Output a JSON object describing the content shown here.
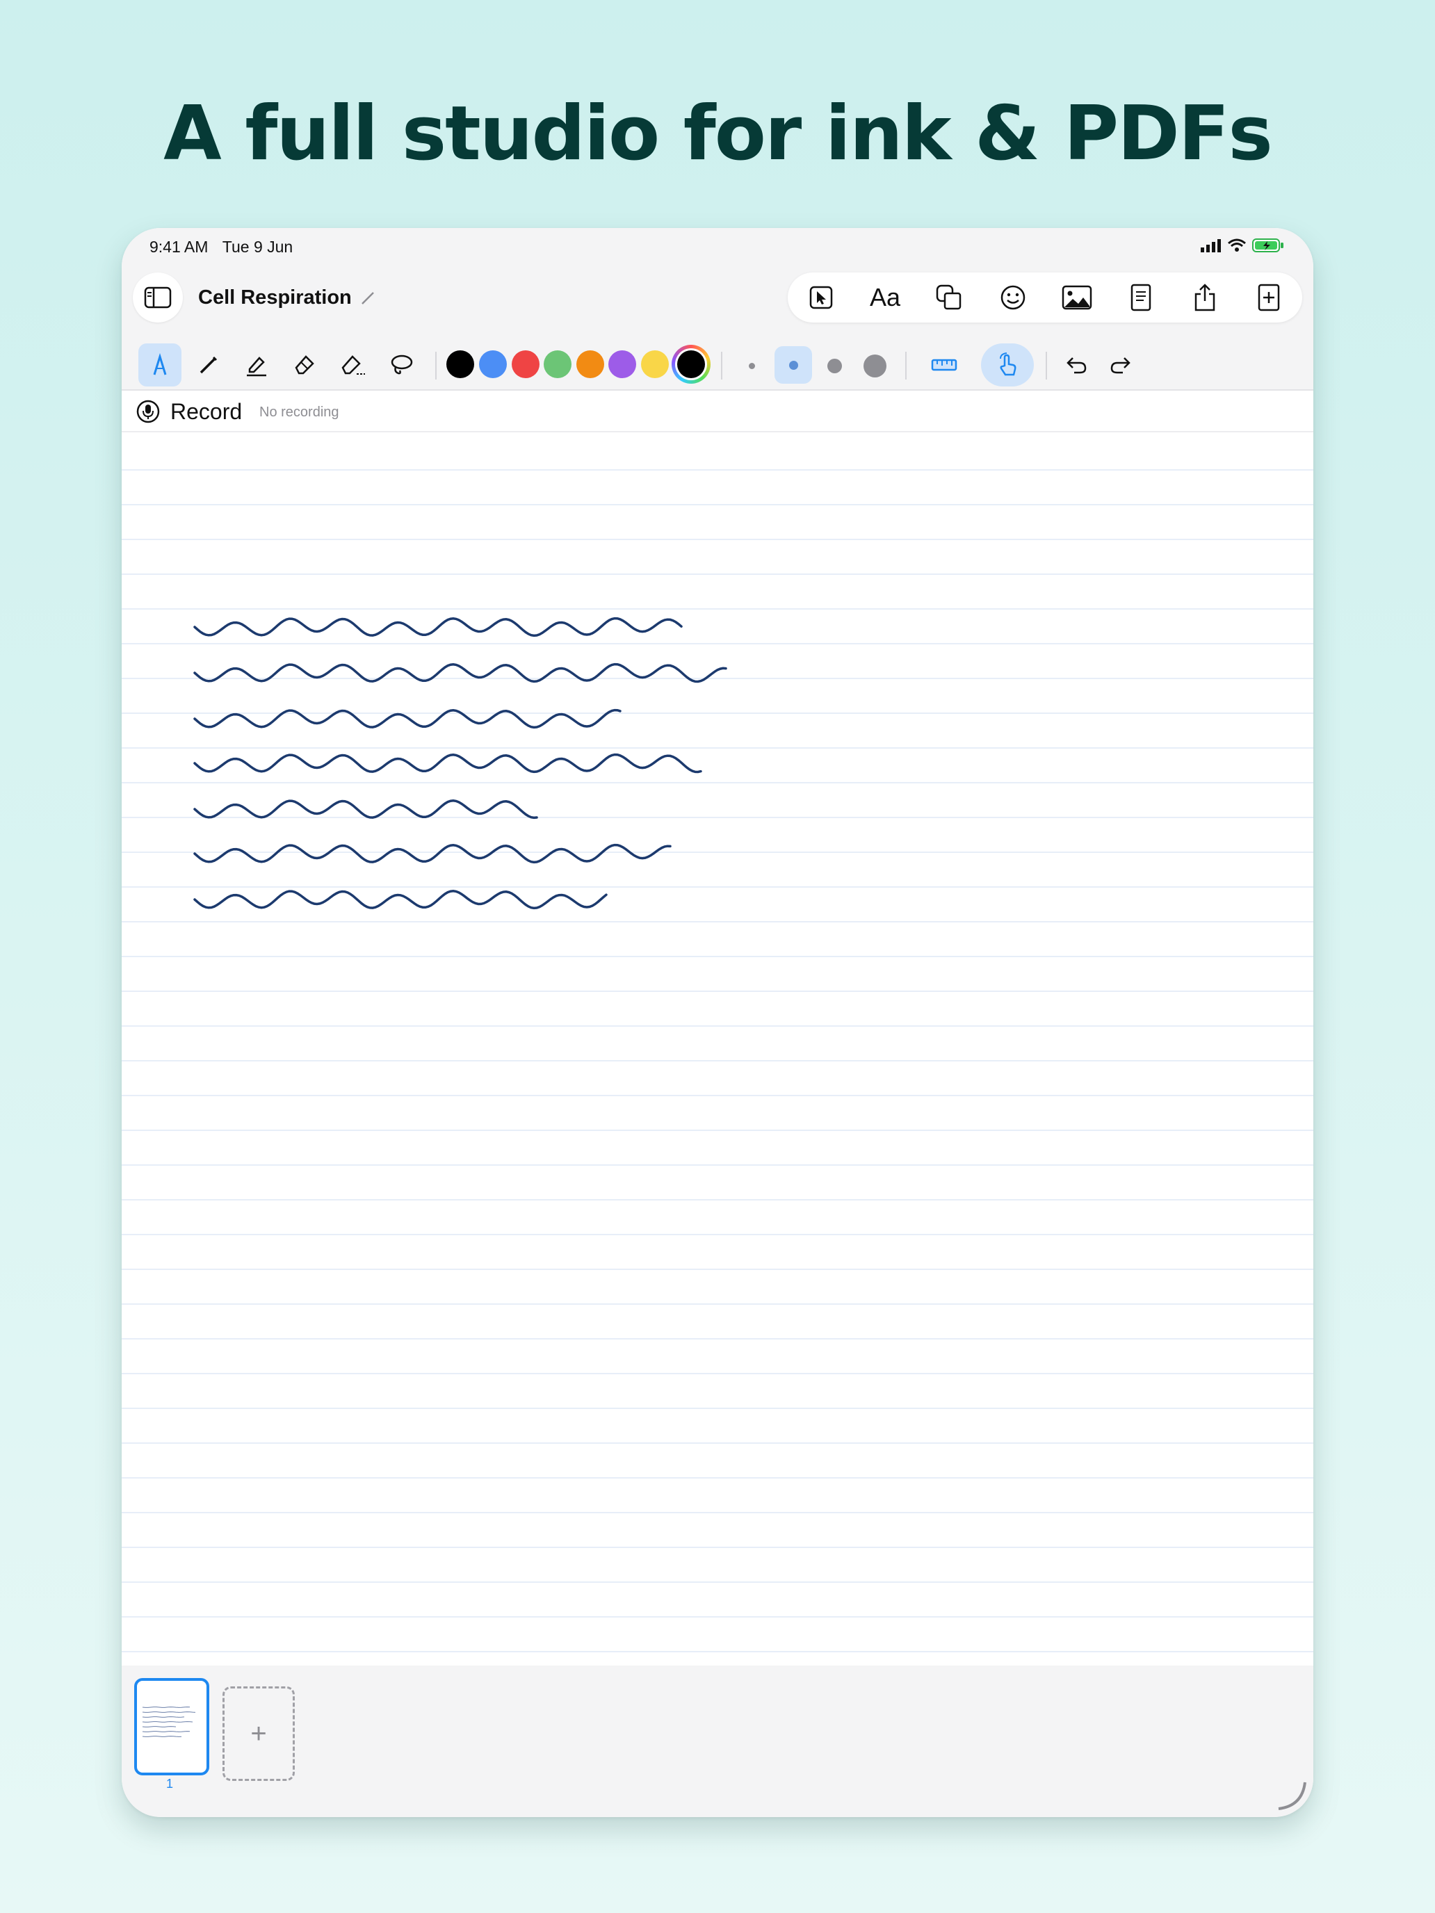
{
  "headline": "A full studio for ink & PDFs",
  "status": {
    "time": "9:41 AM",
    "date": "Tue 9 Jun"
  },
  "document": {
    "title": "Cell Respiration"
  },
  "top_actions": {
    "text_label": "Aa"
  },
  "colors": {
    "accent": "#1e88f0",
    "ink": "#1c3a6e",
    "swatches": [
      "#000000",
      "#4c8ef5",
      "#ef4444",
      "#6cc576",
      "#f28b13",
      "#9d5ce8",
      "#f9d648",
      "#000000"
    ]
  },
  "recording": {
    "label": "Record",
    "status": "No recording"
  },
  "pages": {
    "current_number": "1",
    "add_label": "+"
  },
  "icons": {
    "sidebar": "sidebar-icon",
    "rename": "pencil-icon",
    "select": "pointer-icon",
    "text": "text-icon",
    "shapes": "shapes-icon",
    "emoji": "emoji-icon",
    "image": "image-icon",
    "page": "page-icon",
    "share": "share-icon",
    "add": "add-icon",
    "pen": "pen-icon",
    "pencil": "pencil-icon",
    "highlighter": "highlighter-icon",
    "eraser": "eraser-icon",
    "stroke-eraser": "stroke-eraser-icon",
    "lasso": "lasso-icon",
    "ruler": "ruler-icon",
    "touch": "touch-icon",
    "undo": "undo-icon",
    "redo": "redo-icon",
    "mic": "mic-icon"
  }
}
